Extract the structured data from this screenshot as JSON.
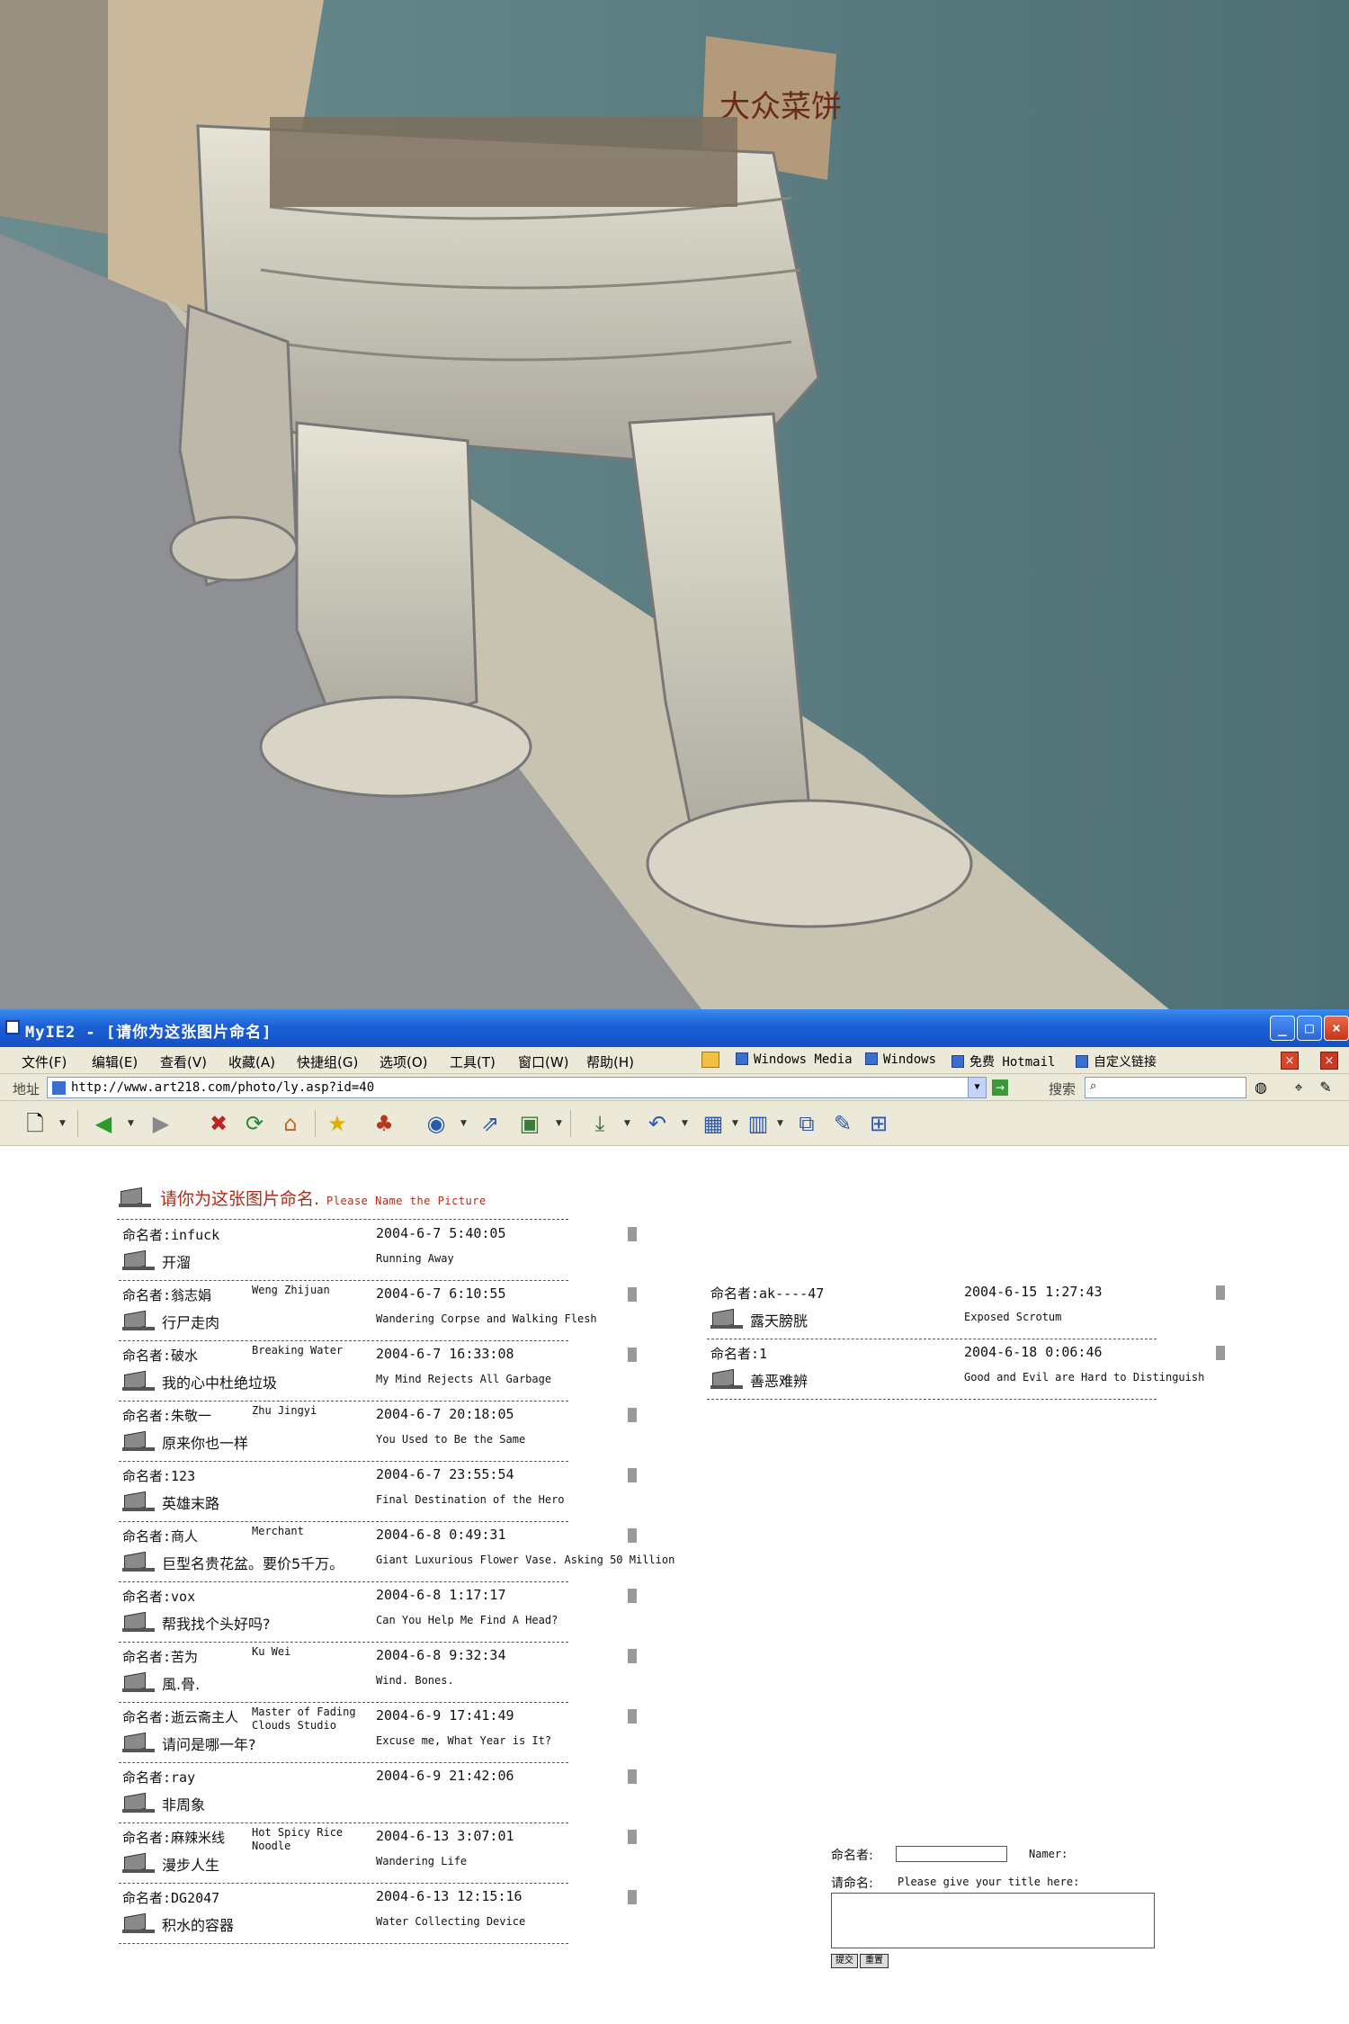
{
  "window": {
    "title": "MyIE2 - [请你为这张图片命名]",
    "buttons": [
      "_",
      "□",
      "×"
    ]
  },
  "menu": {
    "items": [
      "文件(F)",
      "编辑(E)",
      "查看(V)",
      "收藏(A)",
      "快捷组(G)",
      "选项(O)",
      "工具(T)",
      "窗口(W)",
      "帮助(H)"
    ],
    "links": [
      "Windows Media",
      "Windows",
      "免费 Hotmail",
      "自定义链接"
    ]
  },
  "address": {
    "label": "地址",
    "url": "http://www.art218.com/photo/ly.asp?id=40",
    "search_label": "搜索"
  },
  "page": {
    "title_zh": "请你为这张图片命名.",
    "title_en": "Please Name the Picture"
  },
  "namer_prefix": "命名者:",
  "entries_left": [
    {
      "namer": "infuck",
      "namer_en": "",
      "date": "2004-6-7 5:40:05",
      "title_zh": "开溜",
      "title_en": "Running Away"
    },
    {
      "namer": "翁志娟",
      "namer_en": "Weng Zhijuan",
      "date": "2004-6-7 6:10:55",
      "title_zh": "行尸走肉",
      "title_en": "Wandering Corpse and Walking Flesh"
    },
    {
      "namer": "破水",
      "namer_en": "Breaking Water",
      "date": "2004-6-7 16:33:08",
      "title_zh": "我的心中杜绝垃圾",
      "title_en": "My Mind Rejects All Garbage"
    },
    {
      "namer": "朱敬一",
      "namer_en": "Zhu Jingyi",
      "date": "2004-6-7 20:18:05",
      "title_zh": "原来你也一样",
      "title_en": "You Used to Be the Same"
    },
    {
      "namer": "123",
      "namer_en": "",
      "date": "2004-6-7 23:55:54",
      "title_zh": "英雄末路",
      "title_en": "Final Destination of the Hero"
    },
    {
      "namer": "商人",
      "namer_en": "Merchant",
      "date": "2004-6-8 0:49:31",
      "title_zh": "巨型名贵花盆。要价5千万。",
      "title_en": "Giant Luxurious Flower Vase. Asking 50 Million"
    },
    {
      "namer": "vox",
      "namer_en": "",
      "date": "2004-6-8 1:17:17",
      "title_zh": "帮我找个头好吗?",
      "title_en": "Can You Help Me Find A Head?"
    },
    {
      "namer": "苦为",
      "namer_en": "Ku Wei",
      "date": "2004-6-8 9:32:34",
      "title_zh": "風.骨.",
      "title_en": "Wind. Bones."
    },
    {
      "namer": "逝云斋主人",
      "namer_en": "Master of Fading Clouds Studio",
      "date": "2004-6-9 17:41:49",
      "title_zh": "请问是哪一年?",
      "title_en": "Excuse me, What Year is It?"
    },
    {
      "namer": "ray",
      "namer_en": "",
      "date": "2004-6-9 21:42:06",
      "title_zh": "非周象",
      "title_en": ""
    },
    {
      "namer": "麻辣米线",
      "namer_en": "Hot Spicy Rice Noodle",
      "date": "2004-6-13 3:07:01",
      "title_zh": "漫步人生",
      "title_en": "Wandering Life"
    },
    {
      "namer": "DG2047",
      "namer_en": "",
      "date": "2004-6-13 12:15:16",
      "title_zh": "积水的容器",
      "title_en": "Water Collecting Device"
    }
  ],
  "entries_right": [
    {
      "namer": "ak----47",
      "namer_en": "",
      "date": "2004-6-15 1:27:43",
      "title_zh": "露天膀胱",
      "title_en": "Exposed Scrotum"
    },
    {
      "namer": "1",
      "namer_en": "",
      "date": "2004-6-18 0:06:46",
      "title_zh": "善恶难辨",
      "title_en": "Good and Evil are Hard to Distinguish"
    }
  ],
  "form": {
    "namer_label": "命名者:",
    "namer_en": "Namer:",
    "title_label": "请命名:",
    "title_en": "Please give your title here:",
    "submit": "提交",
    "reset": "重置"
  },
  "sign": {
    "text": "大众菜饼"
  }
}
